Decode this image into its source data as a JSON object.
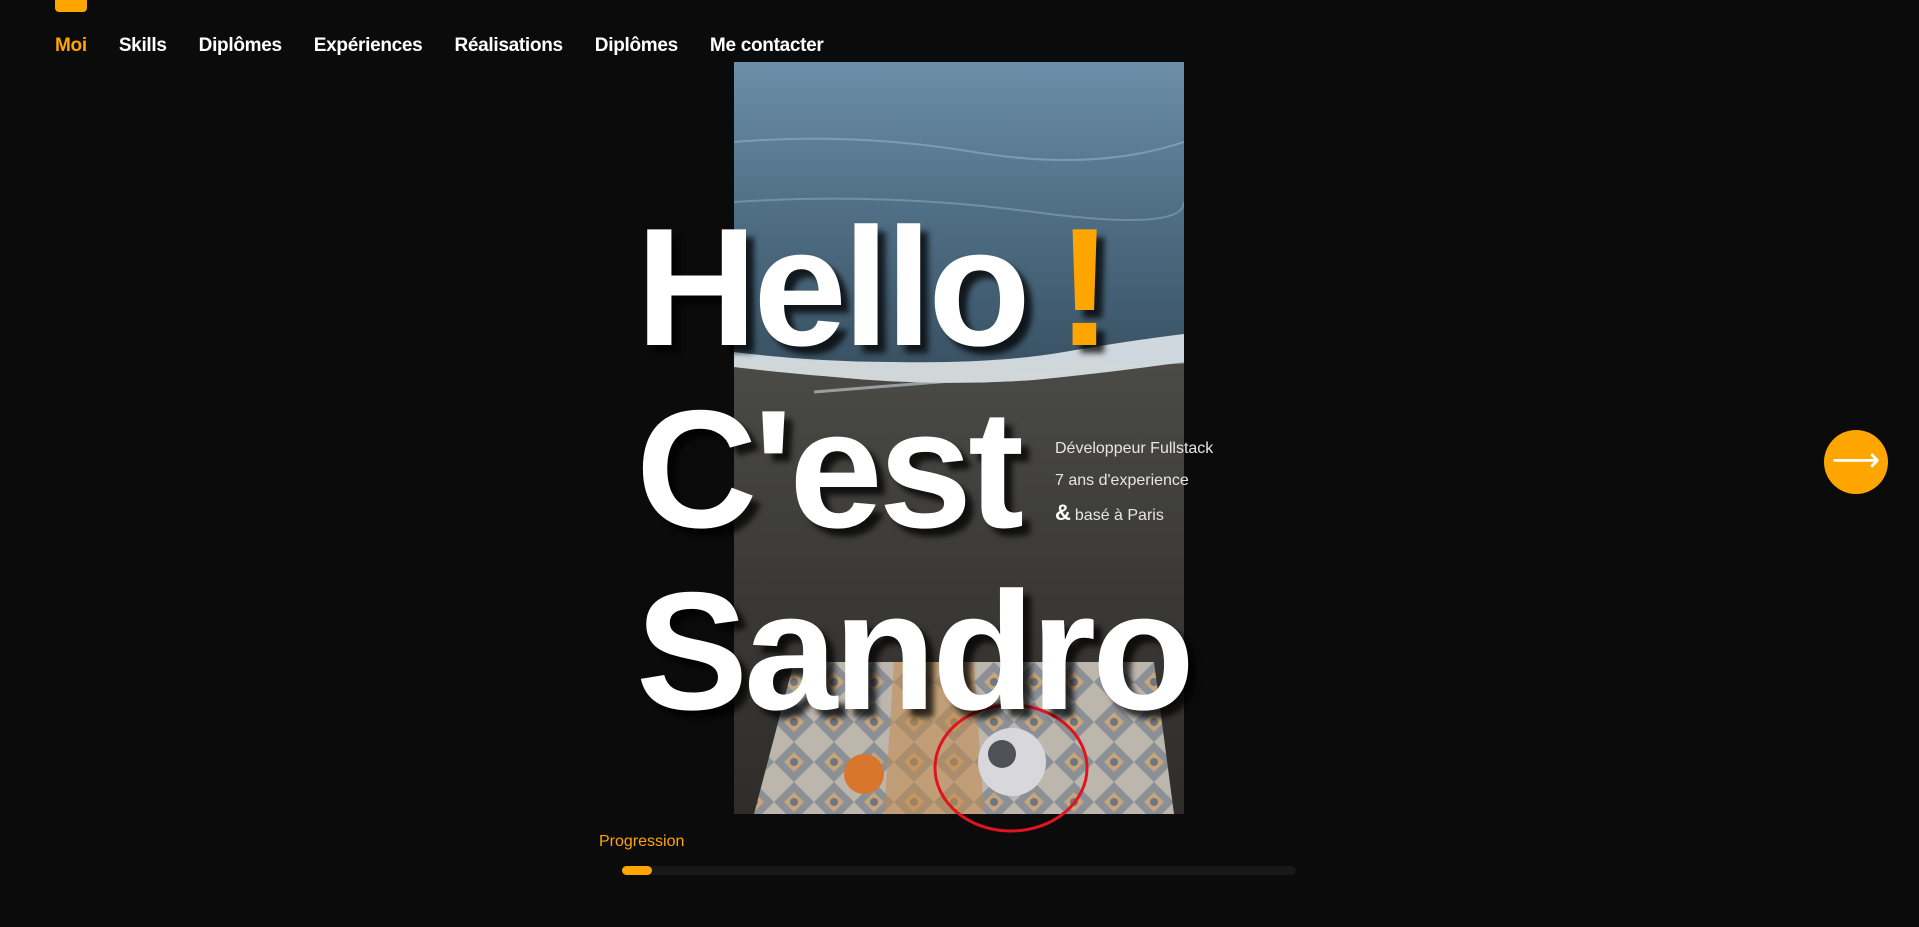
{
  "nav": {
    "items": [
      {
        "label": "Moi",
        "active": true
      },
      {
        "label": "Skills",
        "active": false
      },
      {
        "label": "Diplômes",
        "active": false
      },
      {
        "label": "Expériences",
        "active": false
      },
      {
        "label": "Réalisations",
        "active": false
      },
      {
        "label": "Diplômes",
        "active": false
      },
      {
        "label": "Me contacter",
        "active": false
      }
    ]
  },
  "hero": {
    "line1": "Hello",
    "exclamation": "!",
    "line2": "C'est",
    "line3": "Sandro"
  },
  "profile": {
    "role": "Développeur Fullstack",
    "experience": "7 ans d'experience",
    "ampersand": "&",
    "location": "basé à Paris"
  },
  "next_button": {
    "icon": "arrow-right-icon",
    "glyph": "⟶"
  },
  "progress": {
    "label": "Progression",
    "fraction": 0.045
  },
  "colors": {
    "accent": "#ffa500",
    "background": "#0b0b0b",
    "text": "#ffffff",
    "annotation_circle": "#e0141e"
  }
}
